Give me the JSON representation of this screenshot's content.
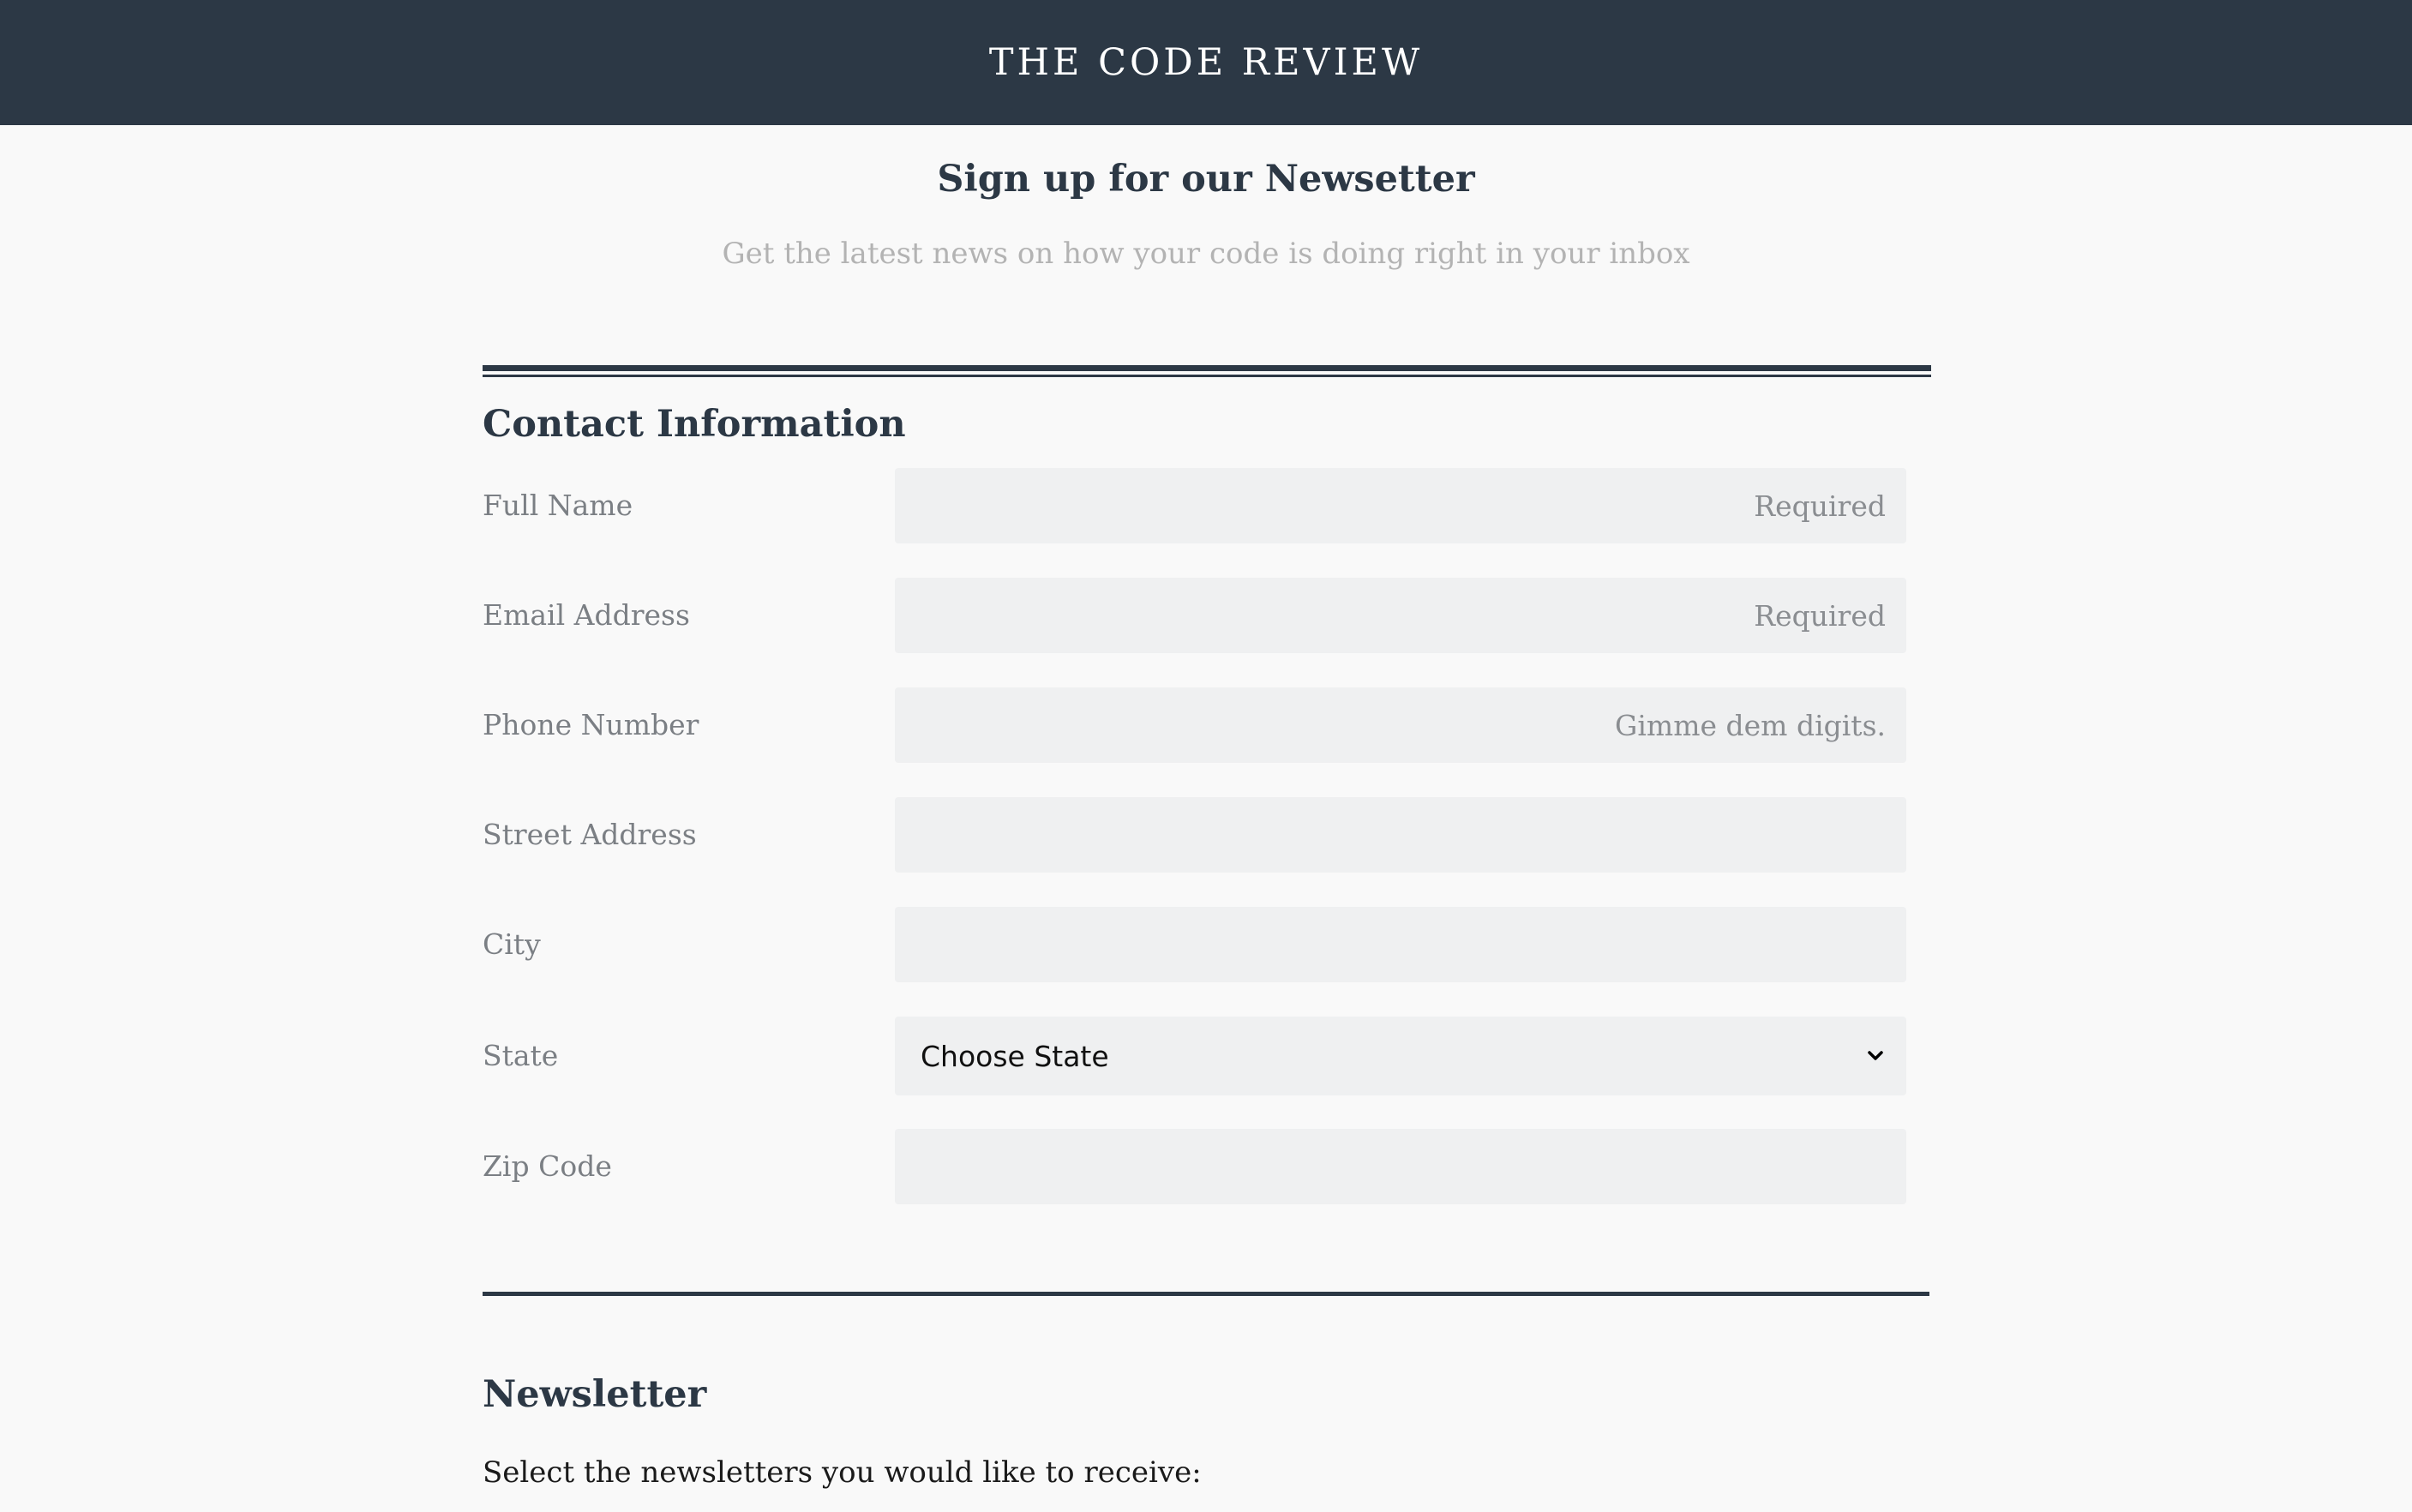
{
  "header": {
    "brand": "THE CODE REVIEW"
  },
  "signup": {
    "title": "Sign up for our Newsetter",
    "subtitle": "Get the latest news on how your code is doing right in your inbox"
  },
  "contact": {
    "title": "Contact Information",
    "fields": {
      "full_name": {
        "label": "Full Name",
        "placeholder": "Required",
        "value": ""
      },
      "email": {
        "label": "Email Address",
        "placeholder": "Required",
        "value": ""
      },
      "phone": {
        "label": "Phone Number",
        "placeholder": "Gimme dem digits.",
        "value": ""
      },
      "street": {
        "label": "Street Address",
        "placeholder": "",
        "value": ""
      },
      "city": {
        "label": "City",
        "placeholder": "",
        "value": ""
      },
      "state": {
        "label": "State",
        "selected": "Choose State"
      },
      "zip": {
        "label": "Zip Code",
        "placeholder": "",
        "value": ""
      }
    }
  },
  "newsletter": {
    "title": "Newsletter",
    "instruction": "Select the newsletters you would like to receive:"
  },
  "colors": {
    "header_bg": "#2c3845",
    "page_bg": "#f9f9f9",
    "field_bg": "#eff0f1",
    "label_text": "#7b7f84",
    "subtitle_text": "#b3b3b3"
  },
  "icons": {
    "select_chevron": "chevron-down-icon"
  }
}
